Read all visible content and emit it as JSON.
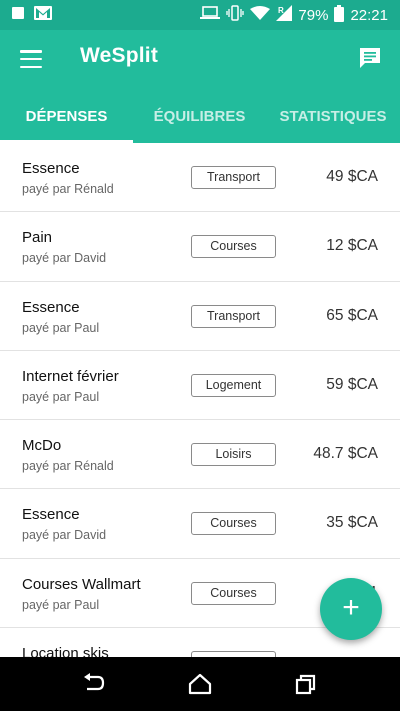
{
  "status_bar": {
    "battery": "79%",
    "time": "22:21",
    "icons": [
      "notification-icon",
      "gmail-icon",
      "laptop-icon",
      "vibrate-icon",
      "wifi-icon",
      "signal-roaming-icon",
      "battery-icon"
    ]
  },
  "app": {
    "title": "WeSplit",
    "menu_icon": "hamburger-menu-icon",
    "action_icon": "chat-message-icon"
  },
  "tabs": [
    {
      "label": "DÉPENSES",
      "active": true
    },
    {
      "label": "ÉQUILIBRES",
      "active": false
    },
    {
      "label": "STATISTIQUES",
      "active": false
    }
  ],
  "expenses": [
    {
      "name": "Essence",
      "payer": "payé par Rénald",
      "category": "Transport",
      "amount": "49 $CA"
    },
    {
      "name": "Pain",
      "payer": "payé par David",
      "category": "Courses",
      "amount": "12 $CA"
    },
    {
      "name": "Essence",
      "payer": "payé par Paul",
      "category": "Transport",
      "amount": "65 $CA"
    },
    {
      "name": "Internet février",
      "payer": "payé par Paul",
      "category": "Logement",
      "amount": "59 $CA"
    },
    {
      "name": "McDo",
      "payer": "payé par Rénald",
      "category": "Loisirs",
      "amount": "48.7 $CA"
    },
    {
      "name": "Essence",
      "payer": "payé par David",
      "category": "Courses",
      "amount": "35 $CA"
    },
    {
      "name": "Courses Wallmart",
      "payer": "payé par Paul",
      "category": "Courses",
      "amount": "1"
    },
    {
      "name": "Location skis",
      "payer": "",
      "category": "",
      "amount": ""
    }
  ],
  "fab": {
    "label": "+",
    "icon": "add-icon"
  },
  "nav": {
    "icons": [
      "back-icon",
      "home-icon",
      "recent-apps-icon"
    ]
  },
  "colors": {
    "primary": "#22bc9c",
    "status_bar": "#1cab8f",
    "nav_bar": "#000000"
  }
}
